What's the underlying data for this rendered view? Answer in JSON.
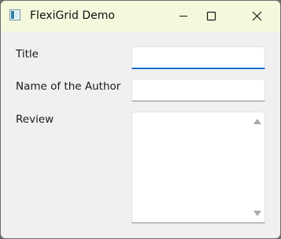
{
  "window": {
    "title": "FlexiGrid Demo",
    "app_icon": "window-app-icon",
    "controls": {
      "minimize_icon": "minimize-icon",
      "maximize_icon": "maximize-icon",
      "close_icon": "close-icon"
    }
  },
  "form": {
    "title_label": "Title",
    "title_value": "",
    "author_label": "Name of the Author",
    "author_value": "",
    "review_label": "Review",
    "review_value": ""
  },
  "colors": {
    "titlebar_background": "#f4f8dc",
    "window_background": "#f0f0f0",
    "focus_accent": "#1a6ecb"
  }
}
